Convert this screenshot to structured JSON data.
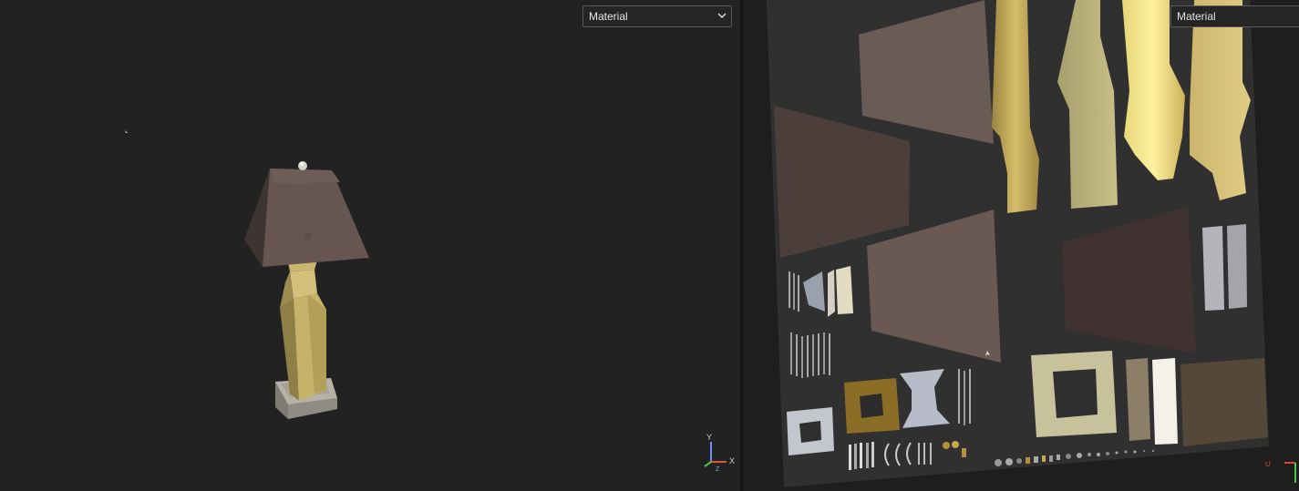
{
  "viewport_3d": {
    "shading_dropdown": {
      "value": "Material"
    },
    "axis_gizmo": {
      "y_label": "Y",
      "x_label": "X",
      "z_label": "Z"
    }
  },
  "viewport_uv": {
    "shading_dropdown": {
      "value": "Material"
    },
    "axis_gizmo": {
      "u_label": "U"
    }
  },
  "colors": {
    "background": "#222222",
    "lampshade": "#5e4e48",
    "lamp_body_gold": "#c8b46a",
    "uv_canvas": "#2f2f2f"
  }
}
